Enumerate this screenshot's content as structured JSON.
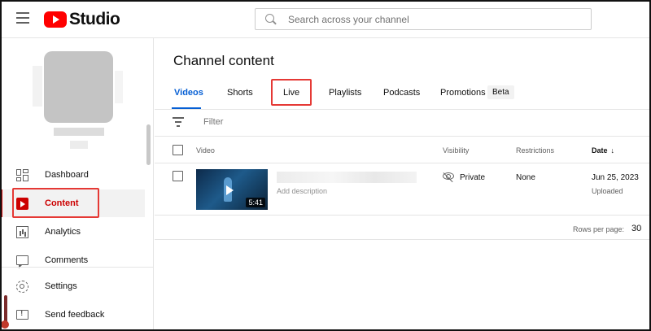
{
  "header": {
    "logo_text": "Studio",
    "search_placeholder": "Search across your channel"
  },
  "sidebar": {
    "items": [
      {
        "label": "Dashboard",
        "icon": "dashboard-icon"
      },
      {
        "label": "Content",
        "icon": "content-icon",
        "active": true
      },
      {
        "label": "Analytics",
        "icon": "analytics-icon"
      },
      {
        "label": "Comments",
        "icon": "comments-icon"
      },
      {
        "label": "Settings",
        "icon": "settings-icon"
      },
      {
        "label": "Send feedback",
        "icon": "feedback-icon"
      }
    ]
  },
  "main": {
    "title": "Channel content",
    "tabs": [
      {
        "label": "Videos",
        "active": true
      },
      {
        "label": "Shorts"
      },
      {
        "label": "Live"
      },
      {
        "label": "Playlists"
      },
      {
        "label": "Podcasts"
      },
      {
        "label": "Promotions"
      }
    ],
    "beta_badge": "Beta",
    "filter_placeholder": "Filter",
    "columns": {
      "video": "Video",
      "visibility": "Visibility",
      "restrictions": "Restrictions",
      "date": "Date",
      "date_sort": "↓"
    },
    "rows": [
      {
        "duration": "5:41",
        "description": "Add description",
        "visibility": "Private",
        "restrictions": "None",
        "date": "Jun 25, 2023",
        "date_status": "Uploaded"
      }
    ],
    "pagination": {
      "rows_per_page_label": "Rows per page:",
      "rows_per_page_value": "30"
    }
  },
  "colors": {
    "accent_blue": "#065fd4",
    "brand_red": "#ff0000",
    "active_red": "#cc0000",
    "highlight_box": "#e53935"
  }
}
